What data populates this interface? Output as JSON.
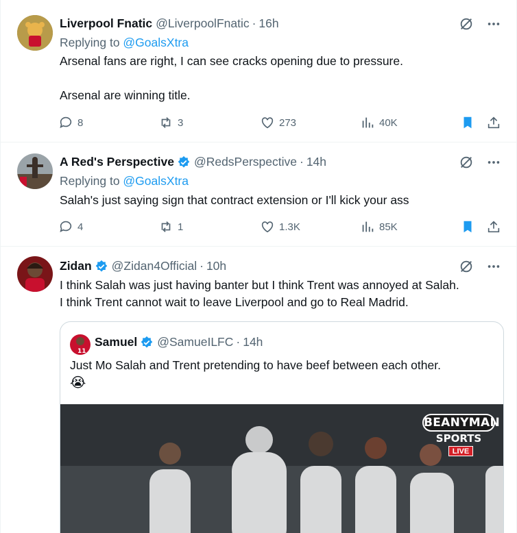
{
  "tweets": [
    {
      "name": "Liverpool Fnatic",
      "handle": "@LiverpoolFnatic",
      "dot": "·",
      "time": "16h",
      "replying_prefix": "Replying to ",
      "replying_to": "@GoalsXtra",
      "text": "Arsenal fans are right, I can see cracks opening due to pressure.\n\nArsenal are winning title.",
      "replies": "8",
      "reposts": "3",
      "likes": "273",
      "views": "40K",
      "verified": false,
      "bookmarked": true
    },
    {
      "name": "A Red's Perspective",
      "handle": "@RedsPerspective",
      "dot": "·",
      "time": "14h",
      "replying_prefix": "Replying to ",
      "replying_to": "@GoalsXtra",
      "text": "Salah's just saying sign that contract extension or I'll kick your ass",
      "replies": "4",
      "reposts": "1",
      "likes": "1.3K",
      "views": "85K",
      "verified": true,
      "bookmarked": true
    },
    {
      "name": "Zidan",
      "handle": "@Zidan4Official",
      "dot": "·",
      "time": "10h",
      "text": "I think Salah was just having banter but I think Trent was annoyed at Salah.\nI think Trent cannot wait to leave Liverpool and go to Real Madrid.",
      "verified": true,
      "quote": {
        "name": "Samuel",
        "handle": "@SamueILFC",
        "dot": "·",
        "time": "14h",
        "text": "Just Mo Salah and Trent pretending to have beef between each other.",
        "emoji": "😭",
        "media_logo": {
          "line1": "BEANYMAN",
          "line2": "SPORTS",
          "line3": "LIVE"
        }
      }
    }
  ],
  "colors": {
    "accent": "#1d9bf0",
    "muted": "#536471",
    "text": "#0f1419",
    "border": "#eff3f4"
  },
  "icons": [
    "grok-icon",
    "more-icon",
    "reply-icon",
    "repost-icon",
    "like-icon",
    "views-icon",
    "bookmark-icon",
    "share-icon",
    "verified-icon"
  ]
}
